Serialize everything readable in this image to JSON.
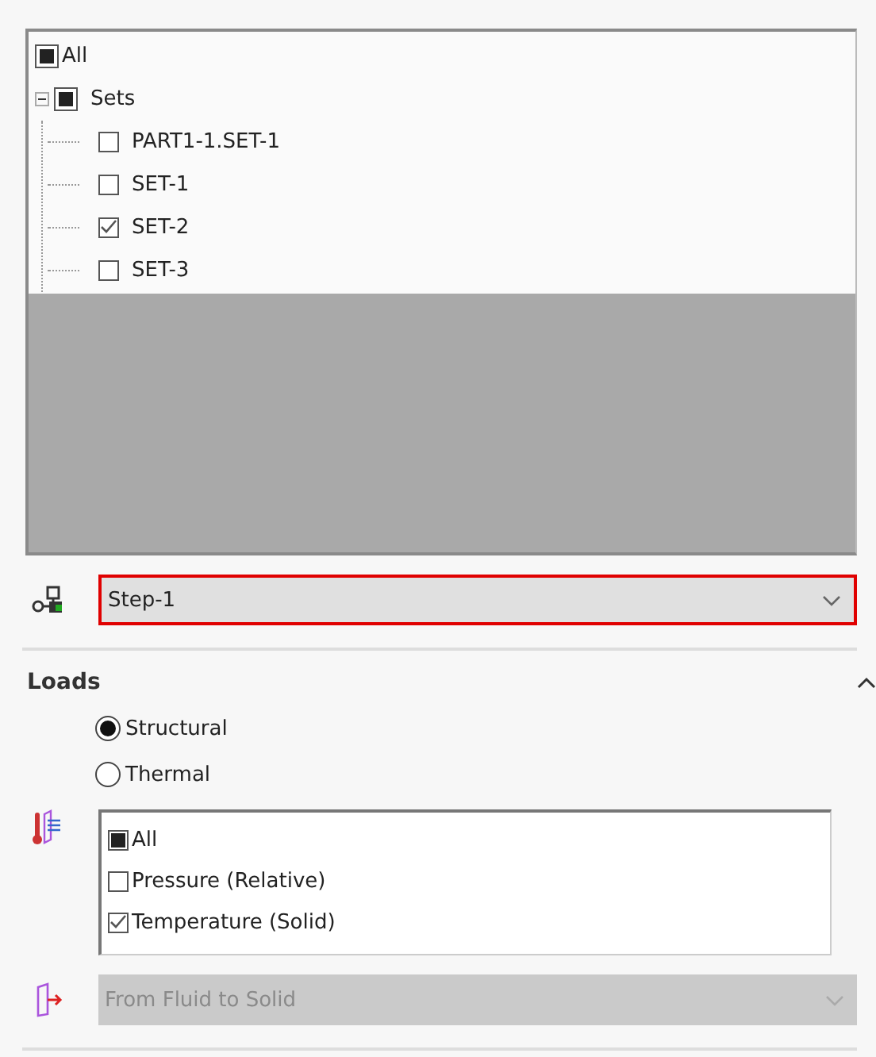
{
  "tree": {
    "items": [
      {
        "label": "All",
        "checked": true,
        "indeterminate": true
      },
      {
        "label": "Sets",
        "checked": true,
        "indeterminate": true,
        "expanded": true,
        "children": [
          {
            "label": "PART1-1.SET-1",
            "checked": false
          },
          {
            "label": "SET-1",
            "checked": false
          },
          {
            "label": "SET-2",
            "checked": true
          },
          {
            "label": "SET-3",
            "checked": false
          }
        ]
      }
    ]
  },
  "step": {
    "value": "Step-1",
    "highlighted": true
  },
  "loads": {
    "title": "Loads",
    "expanded": true,
    "radios": [
      {
        "label": "Structural",
        "selected": true
      },
      {
        "label": "Thermal",
        "selected": false
      }
    ],
    "list": [
      {
        "label": "All",
        "checked": true,
        "indeterminate": true
      },
      {
        "label": "Pressure (Relative)",
        "checked": false
      },
      {
        "label": "Temperature (Solid)",
        "checked": true
      }
    ],
    "direction": {
      "value": "From Fluid to Solid",
      "disabled": true
    }
  }
}
